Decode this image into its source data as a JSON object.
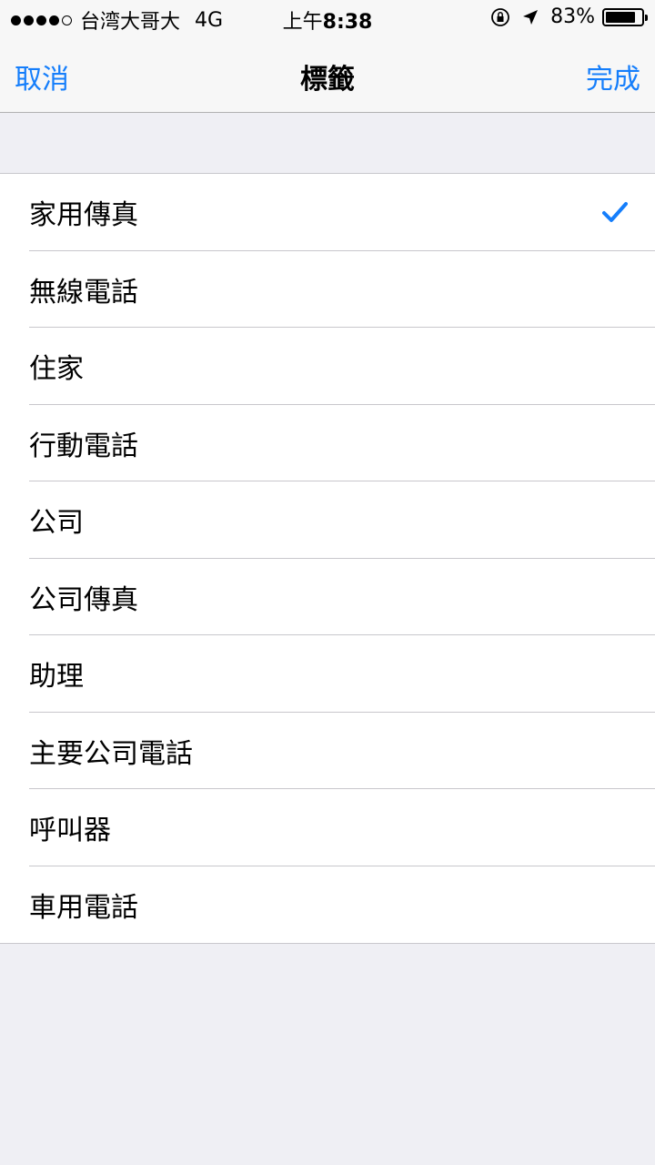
{
  "status_bar": {
    "signal_dots": 5,
    "carrier": "台湾大哥大",
    "network": "4G",
    "time_prefix": "上午",
    "time": "8:38",
    "battery_percent": "83%",
    "battery_level": 0.83
  },
  "nav": {
    "cancel_label": "取消",
    "title": "標籤",
    "done_label": "完成"
  },
  "labels": {
    "selected_index": 0,
    "items": [
      "家用傳真",
      "無線電話",
      "住家",
      "行動電話",
      "公司",
      "公司傳真",
      "助理",
      "主要公司電話",
      "呼叫器",
      "車用電話"
    ]
  },
  "colors": {
    "accent": "#157efb",
    "background": "#efeff4",
    "separator": "#c8c7cc"
  }
}
